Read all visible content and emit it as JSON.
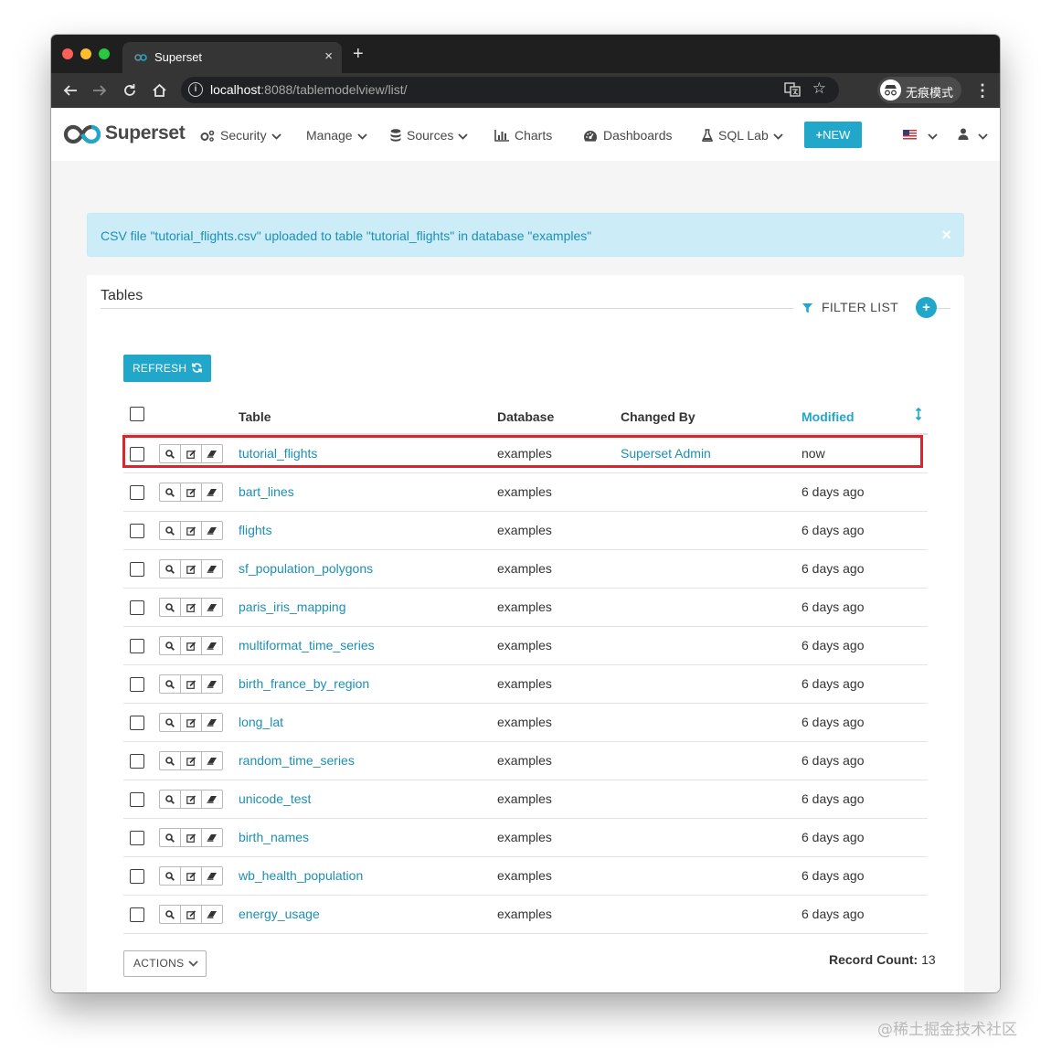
{
  "browser": {
    "tab_title": "Superset",
    "new_tab": "+",
    "tab_close": "×",
    "url_host": "localhost",
    "url_path": ":8088/tablemodelview/list/",
    "incognito_label": "无痕模式"
  },
  "navbar": {
    "brand": "Superset",
    "items": [
      {
        "label": "Security",
        "icon": "cogs-icon",
        "dropdown": true
      },
      {
        "label": "Manage",
        "icon": "",
        "dropdown": true
      },
      {
        "label": "Sources",
        "icon": "database-icon",
        "dropdown": true
      },
      {
        "label": "Charts",
        "icon": "bar-chart-icon",
        "dropdown": false
      },
      {
        "label": "Dashboards",
        "icon": "dashboard-icon",
        "dropdown": false
      },
      {
        "label": "SQL Lab",
        "icon": "flask-icon",
        "dropdown": true
      }
    ],
    "new_button": "NEW",
    "new_button_plus": "+",
    "accent_color": "#20a7c9"
  },
  "alert": {
    "message": "CSV file \"tutorial_flights.csv\" uploaded to table \"tutorial_flights\" in database \"examples\"",
    "close": "×"
  },
  "panel": {
    "title": "Tables",
    "filter_list": "FILTER LIST",
    "add_symbol": "+",
    "refresh_label": "REFRESH",
    "columns": {
      "table": "Table",
      "database": "Database",
      "changed_by": "Changed By",
      "modified": "Modified"
    },
    "rows": [
      {
        "table": "tutorial_flights",
        "database": "examples",
        "changed_by": "Superset Admin",
        "modified": "now",
        "highlighted": true
      },
      {
        "table": "bart_lines",
        "database": "examples",
        "changed_by": "",
        "modified": "6 days ago"
      },
      {
        "table": "flights",
        "database": "examples",
        "changed_by": "",
        "modified": "6 days ago"
      },
      {
        "table": "sf_population_polygons",
        "database": "examples",
        "changed_by": "",
        "modified": "6 days ago"
      },
      {
        "table": "paris_iris_mapping",
        "database": "examples",
        "changed_by": "",
        "modified": "6 days ago"
      },
      {
        "table": "multiformat_time_series",
        "database": "examples",
        "changed_by": "",
        "modified": "6 days ago"
      },
      {
        "table": "birth_france_by_region",
        "database": "examples",
        "changed_by": "",
        "modified": "6 days ago"
      },
      {
        "table": "long_lat",
        "database": "examples",
        "changed_by": "",
        "modified": "6 days ago"
      },
      {
        "table": "random_time_series",
        "database": "examples",
        "changed_by": "",
        "modified": "6 days ago"
      },
      {
        "table": "unicode_test",
        "database": "examples",
        "changed_by": "",
        "modified": "6 days ago"
      },
      {
        "table": "birth_names",
        "database": "examples",
        "changed_by": "",
        "modified": "6 days ago"
      },
      {
        "table": "wb_health_population",
        "database": "examples",
        "changed_by": "",
        "modified": "6 days ago"
      },
      {
        "table": "energy_usage",
        "database": "examples",
        "changed_by": "",
        "modified": "6 days ago"
      }
    ],
    "actions_label": "ACTIONS",
    "record_count_label": "Record Count:",
    "record_count": "13"
  },
  "watermark": "@稀土掘金技术社区"
}
